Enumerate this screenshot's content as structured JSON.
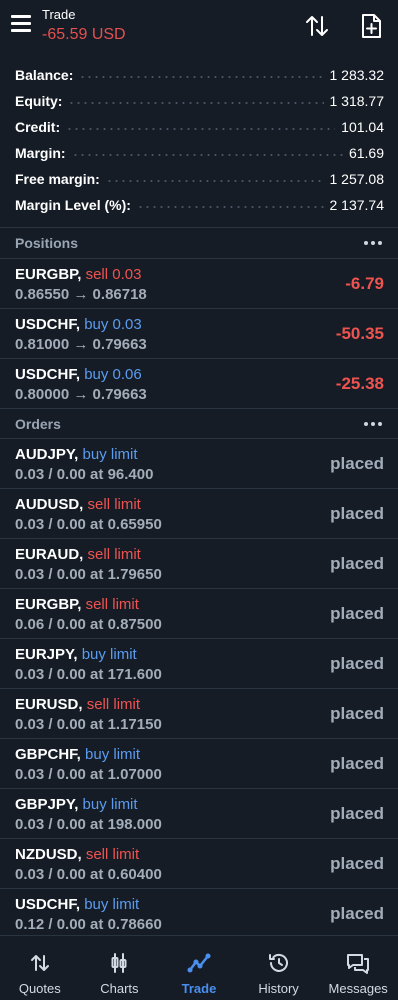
{
  "header": {
    "title": "Trade",
    "profit": "-65.59 USD",
    "icons": [
      "menu-icon",
      "sort-icon",
      "new-order-icon"
    ]
  },
  "summary": [
    {
      "label": "Balance:",
      "value": "1 283.32"
    },
    {
      "label": "Equity:",
      "value": "1 318.77"
    },
    {
      "label": "Credit:",
      "value": "101.04"
    },
    {
      "label": "Margin:",
      "value": "61.69"
    },
    {
      "label": "Free margin:",
      "value": "1 257.08"
    },
    {
      "label": "Margin Level (%):",
      "value": "2 137.74"
    }
  ],
  "positions": {
    "title": "Positions",
    "items": [
      {
        "symbol": "EURGBP,",
        "side": "sell 0.03",
        "type": "sell",
        "prices": "0.86550 → 0.86718",
        "profit": "-6.79"
      },
      {
        "symbol": "USDCHF,",
        "side": "buy 0.03",
        "type": "buy",
        "prices": "0.81000 → 0.79663",
        "profit": "-50.35"
      },
      {
        "symbol": "USDCHF,",
        "side": "buy 0.06",
        "type": "buy",
        "prices": "0.80000 → 0.79663",
        "profit": "-25.38"
      }
    ]
  },
  "orders": {
    "title": "Orders",
    "items": [
      {
        "symbol": "AUDJPY,",
        "side": "buy limit",
        "type": "buy",
        "details": "0.03 / 0.00 at 96.400",
        "status": "placed"
      },
      {
        "symbol": "AUDUSD,",
        "side": "sell limit",
        "type": "sell",
        "details": "0.03 / 0.00 at 0.65950",
        "status": "placed"
      },
      {
        "symbol": "EURAUD,",
        "side": "sell limit",
        "type": "sell",
        "details": "0.03 / 0.00 at 1.79650",
        "status": "placed"
      },
      {
        "symbol": "EURGBP,",
        "side": "sell limit",
        "type": "sell",
        "details": "0.06 / 0.00 at 0.87500",
        "status": "placed"
      },
      {
        "symbol": "EURJPY,",
        "side": "buy limit",
        "type": "buy",
        "details": "0.03 / 0.00 at 171.600",
        "status": "placed"
      },
      {
        "symbol": "EURUSD,",
        "side": "sell limit",
        "type": "sell",
        "details": "0.03 / 0.00 at 1.17150",
        "status": "placed"
      },
      {
        "symbol": "GBPCHF,",
        "side": "buy limit",
        "type": "buy",
        "details": "0.03 / 0.00 at 1.07000",
        "status": "placed"
      },
      {
        "symbol": "GBPJPY,",
        "side": "buy limit",
        "type": "buy",
        "details": "0.03 / 0.00 at 198.000",
        "status": "placed"
      },
      {
        "symbol": "NZDUSD,",
        "side": "sell limit",
        "type": "sell",
        "details": "0.03 / 0.00 at 0.60400",
        "status": "placed"
      },
      {
        "symbol": "USDCHF,",
        "side": "buy limit",
        "type": "buy",
        "details": "0.12 / 0.00 at 0.78660",
        "status": "placed"
      }
    ]
  },
  "nav": [
    {
      "label": "Quotes",
      "icon": "quotes-icon",
      "active": false
    },
    {
      "label": "Charts",
      "icon": "charts-icon",
      "active": false
    },
    {
      "label": "Trade",
      "icon": "trade-icon",
      "active": true
    },
    {
      "label": "History",
      "icon": "history-icon",
      "active": false
    },
    {
      "label": "Messages",
      "icon": "messages-icon",
      "active": false
    }
  ],
  "colors": {
    "background": "#151c25",
    "sell": "#ef5350",
    "buy": "#5b9cf0",
    "active": "#4a8ff0",
    "muted": "#a3adb9"
  }
}
